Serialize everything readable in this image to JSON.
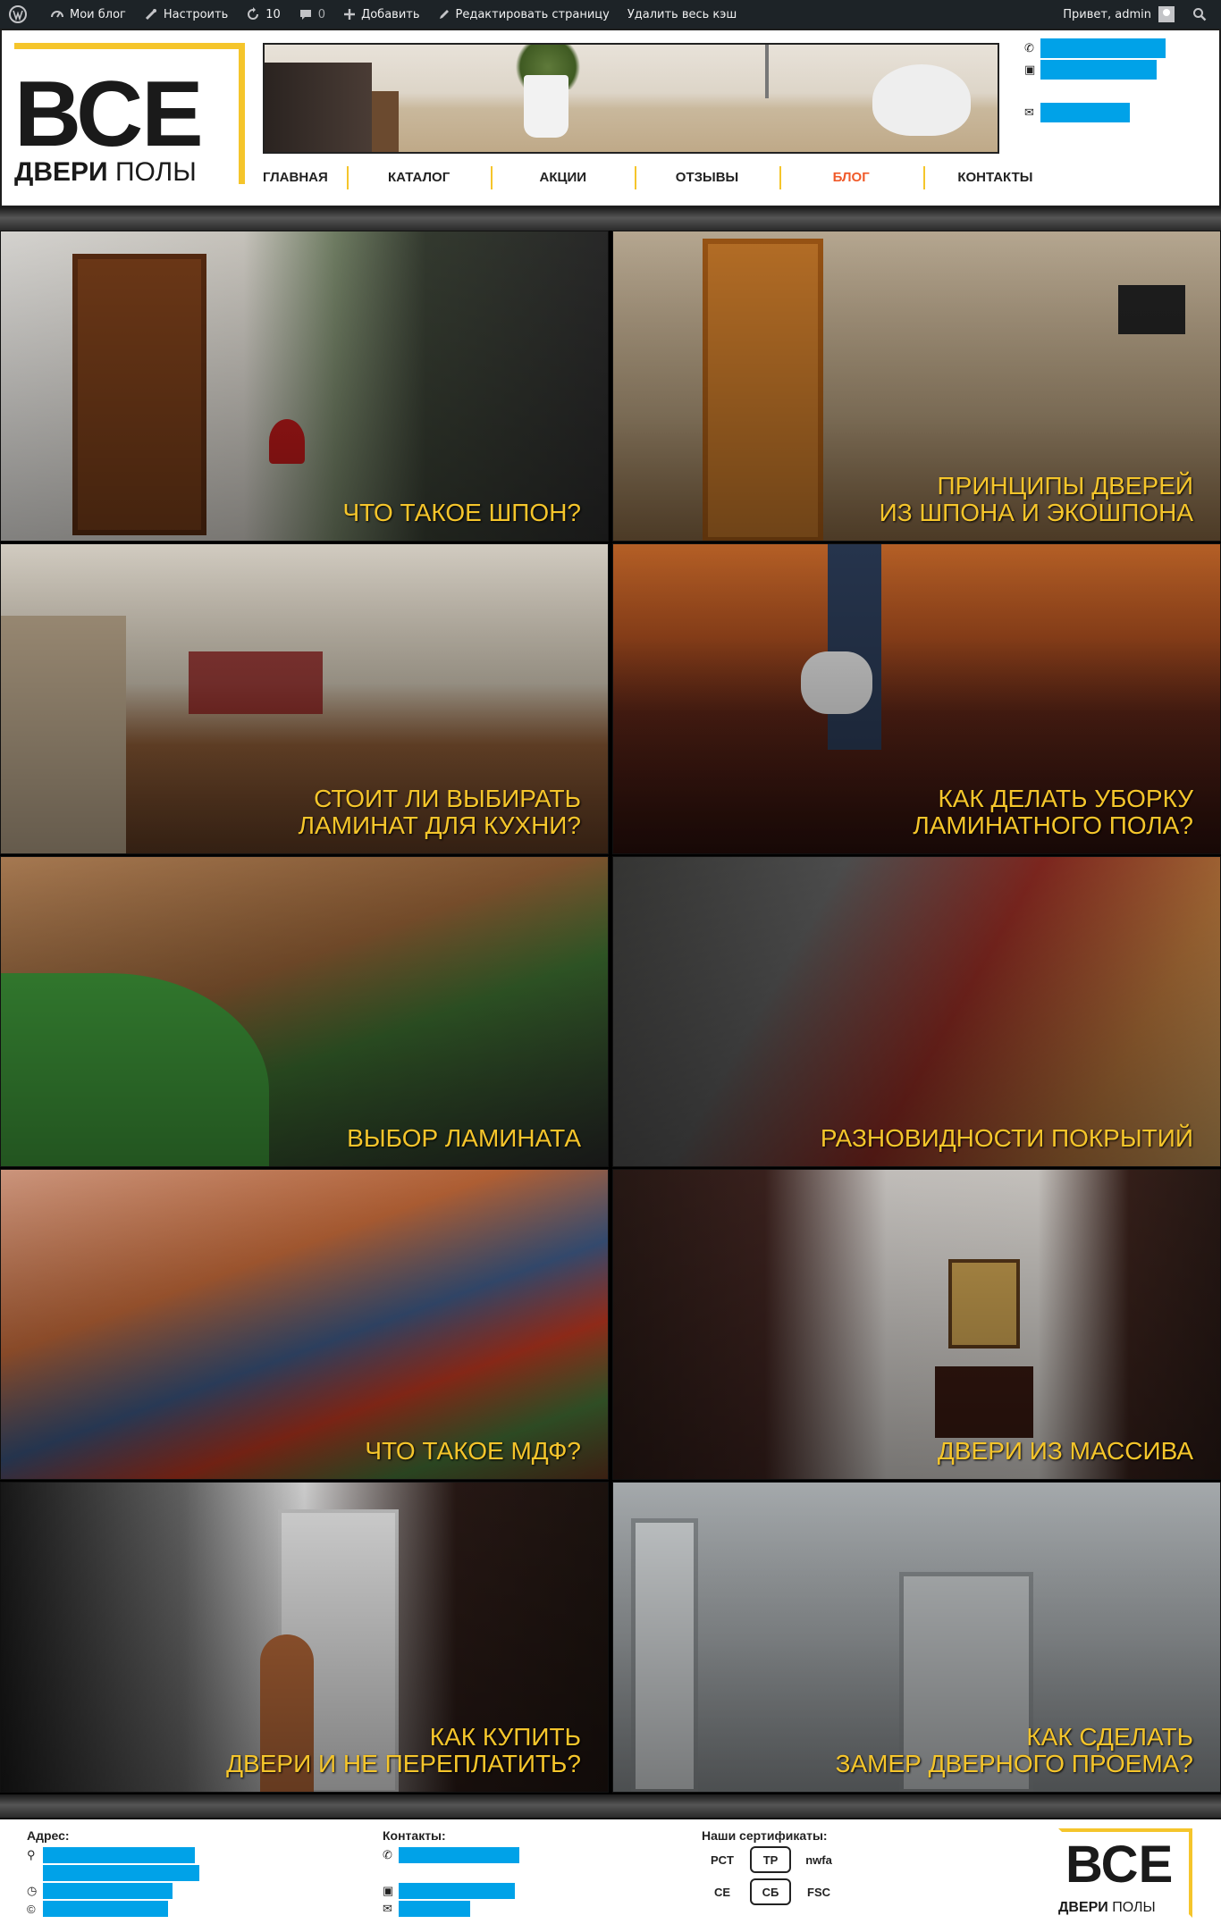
{
  "admin_bar": {
    "my_blogs": "Мои блог",
    "customize": "Настроить",
    "updates_count": "10",
    "comments_count": "0",
    "add_new": "Добавить",
    "edit_page": "Редактировать страницу",
    "clear_cache": "Удалить весь кэш",
    "greeting": "Привет, admin"
  },
  "logo": {
    "big": "ВСЕ",
    "small_bold": "ДВЕРИ",
    "small_regular": " ПОЛЫ"
  },
  "nav": {
    "items": [
      {
        "label": "ГЛАВНАЯ"
      },
      {
        "label": "КАТАЛОГ"
      },
      {
        "label": "АКЦИИ"
      },
      {
        "label": "ОТЗЫВЫ"
      },
      {
        "label": "БЛОГ"
      },
      {
        "label": "КОНТАКТЫ"
      }
    ],
    "active_color": "#f05a2a"
  },
  "tiles": [
    {
      "title_l1": "ЧТО ТАКОЕ ШПОН?",
      "title_l2": ""
    },
    {
      "title_l1": "ПРИНЦИПЫ ДВЕРЕЙ",
      "title_l2": "ИЗ ШПОНА И ЭКОШПОНА"
    },
    {
      "title_l1": "СТОИТ ЛИ ВЫБИРАТЬ",
      "title_l2": "ЛАМИНАТ ДЛЯ КУХНИ?"
    },
    {
      "title_l1": "КАК ДЕЛАТЬ УБОРКУ",
      "title_l2": "ЛАМИНАТНОГО ПОЛА?"
    },
    {
      "title_l1": "ВЫБОР ЛАМИНАТА",
      "title_l2": ""
    },
    {
      "title_l1": "РАЗНОВИДНОСТИ ПОКРЫТИЙ",
      "title_l2": ""
    },
    {
      "title_l1": "ЧТО ТАКОЕ МДФ?",
      "title_l2": ""
    },
    {
      "title_l1": "ДВЕРИ ИЗ МАССИВА",
      "title_l2": ""
    },
    {
      "title_l1": "КАК КУПИТЬ",
      "title_l2": "ДВЕРИ И НЕ ПЕРЕПЛАТИТЬ?"
    },
    {
      "title_l1": "КАК СДЕЛАТЬ",
      "title_l2": "ЗАМЕР ДВЕРНОГО ПРОЕМА?"
    }
  ],
  "footer": {
    "address_heading": "Адрес:",
    "contacts_heading": "Контакты:",
    "certificates_heading": "Наши сертификаты:",
    "certificates": [
      "PCT",
      "TP",
      "nwfa",
      "CE",
      "СБ",
      "FSC"
    ]
  },
  "colors": {
    "accent": "#f5c52b",
    "redaction": "#00a2e8",
    "admin_bar": "#1d2327"
  }
}
